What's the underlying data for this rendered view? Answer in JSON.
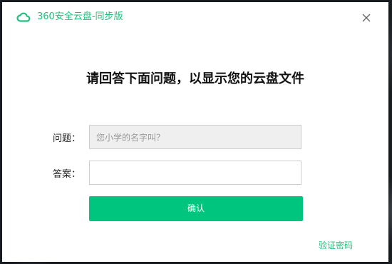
{
  "window": {
    "app_title": "360安全云盘-同步版",
    "logo_icon": "cloud-logo-icon",
    "close_icon": "close-icon"
  },
  "main": {
    "headline": "请回答下面问题，以显示您的云盘文件",
    "question_label": "问题：",
    "question_value": "您小学的名字叫？",
    "answer_label": "答案：",
    "answer_value": "",
    "confirm_label": "确认",
    "verify_password_link": "验证密码"
  },
  "colors": {
    "accent": "#00c57f",
    "title_text": "#1fbf7c",
    "readonly_field_bg": "#efefef"
  }
}
